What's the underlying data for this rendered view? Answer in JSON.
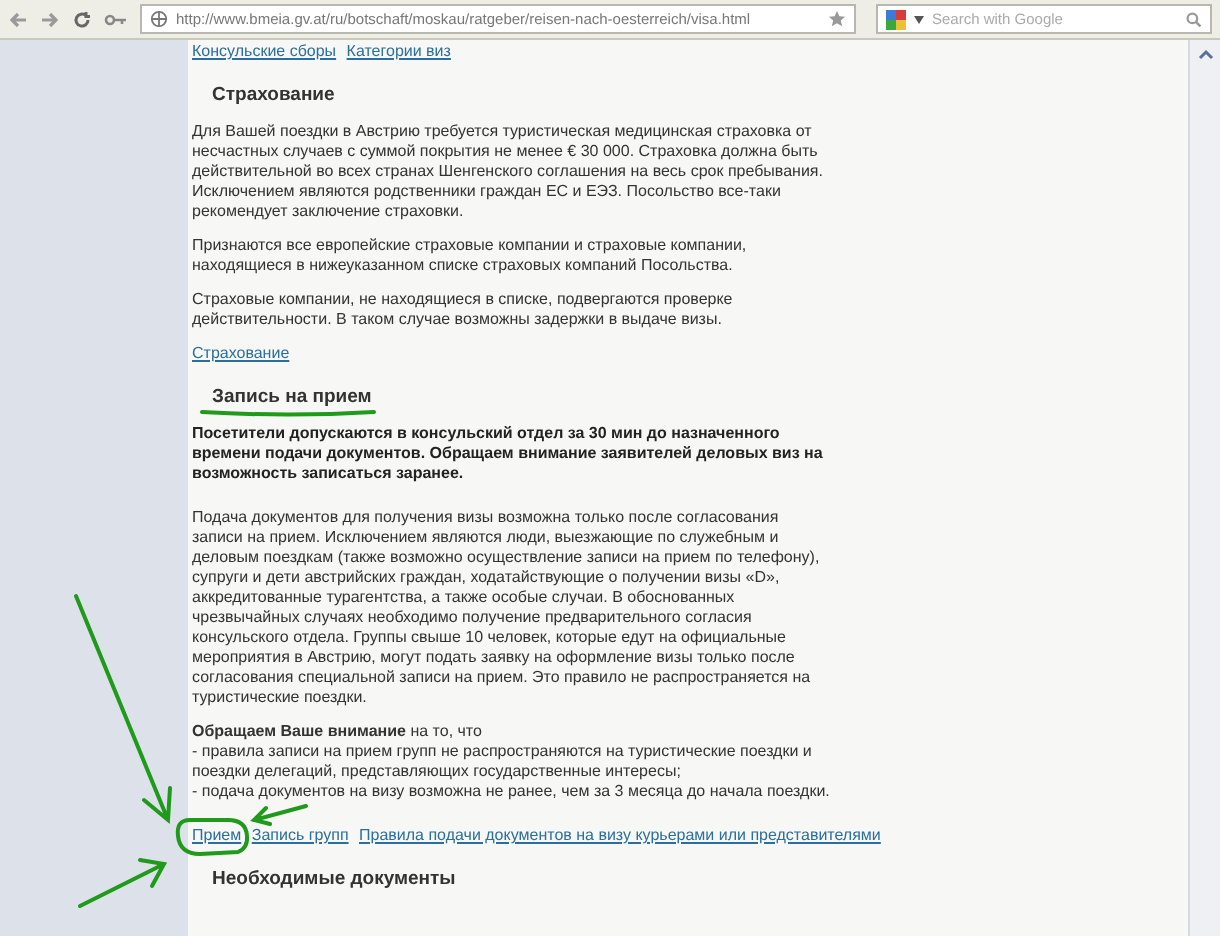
{
  "browser": {
    "url": "http://www.bmeia.gv.at/ru/botschaft/moskau/ratgeber/reisen-nach-oesterreich/visa.html",
    "search_placeholder": "Search with Google"
  },
  "blocks": [
    {
      "kind": "links",
      "items": [
        "Консульские сборы",
        "Категории виз"
      ]
    },
    {
      "kind": "heading",
      "text": "Страхование"
    },
    {
      "kind": "paragraph",
      "text": "Для Вашей поездки в Австрию требуется туристическая медицинская страховка от несчастных случаев с суммой покрытия не менее € 30 000. Страховка должна быть действительной во всех странах Шенгенского соглашения на весь срок пребывания. Исключением являются родственники граждан ЕС и ЕЭЗ. Посольство все-таки рекомендует заключение страховки."
    },
    {
      "kind": "paragraph",
      "text": "Признаются все европейские страховые компании и страховые компании, находящиеся в нижеуказанном списке страховых компаний Посольства."
    },
    {
      "kind": "paragraph",
      "text": "Страховые компании, не находящиеся в списке, подвергаются проверке действительности. В таком случае возможны задержки в выдаче визы."
    },
    {
      "kind": "links",
      "items": [
        "Страхование"
      ]
    },
    {
      "kind": "heading",
      "text": "Запись на прием"
    },
    {
      "kind": "bold_paragraph",
      "text": "Посетители допускаются в консульский отдел за 30 мин до назначенного времени подачи документов. Обращаем внимание заявителей  деловых виз на возможность записаться заранее."
    },
    {
      "kind": "paragraph",
      "text": "Подача документов для получения визы возможна только после согласования записи на прием.  Исключением являются люди, выезжающие по служебным и деловым поездкам (также возможно осуществление записи на прием по телефону), супруги и дети австрийских граждан, ходатайствующие о получении визы «D», аккредитованные турагентства, а также особые случаи.  В обоснованных чрезвычайных случаях необходимо получение предварительного согласия консульского отдела. Группы свыше 10 человек, которые едут на официальные мероприятия в Австрию, могут подать заявку на оформление визы только после согласования специальной записи на прием. Это правило не распространяется на туристические поездки."
    },
    {
      "kind": "lines",
      "items": [
        "**Обращаем Ваше внимание** на то, что",
        "- правила записи на прием групп не распространяются на туристические поездки и",
        " поездки делегаций, представляющих государственные интересы;",
        "- подача документов на визу возможна не ранее, чем за 3 месяца до начала поездки."
      ]
    },
    {
      "kind": "links",
      "items": [
        "Прием",
        "Запись групп",
        "Правила подачи документов на визу курьерами или представителями"
      ]
    },
    {
      "kind": "heading",
      "text": "Необходимые документы"
    }
  ]
}
